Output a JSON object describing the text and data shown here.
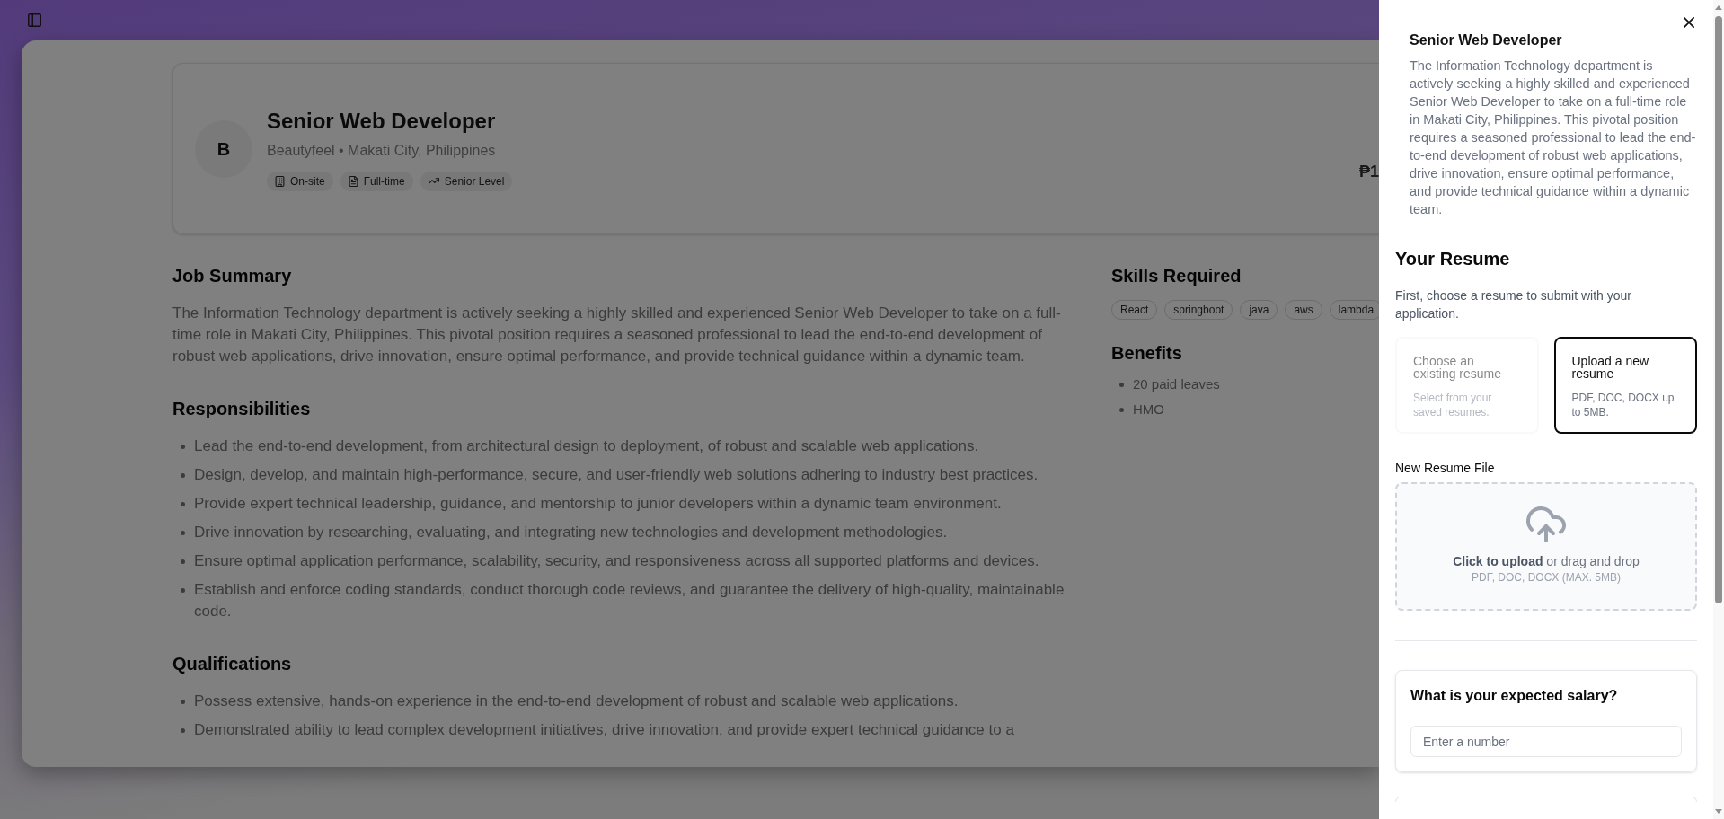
{
  "job": {
    "initial": "B",
    "title": "Senior Web Developer",
    "subtitle": "Beautyfeel • Makati City, Philippines",
    "tags": [
      {
        "kind": "workplace",
        "label": "On-site"
      },
      {
        "kind": "employment",
        "label": "Full-time"
      },
      {
        "kind": "level",
        "label": "Senior Level"
      }
    ],
    "salary": "₱1"
  },
  "sections": [
    {
      "kind": "paragraph",
      "heading": "Job Summary",
      "text": "The Information Technology department is actively seeking a highly skilled and experienced Senior Web Developer to take on a full-time role in Makati City, Philippines. This pivotal position requires a seasoned professional to lead the end-to-end development of robust web applications, drive innovation, ensure optimal performance, and provide technical guidance within a dynamic team."
    },
    {
      "kind": "list",
      "heading": "Responsibilities",
      "items": [
        "Lead the end-to-end development, from architectural design to deployment, of robust and scalable web applications.",
        "Design, develop, and maintain high-performance, secure, and user-friendly web solutions adhering to industry best practices.",
        "Provide expert technical leadership, guidance, and mentorship to junior developers within a dynamic team environment.",
        "Drive innovation by researching, evaluating, and integrating new technologies and development methodologies.",
        "Ensure optimal application performance, scalability, security, and responsiveness across all supported platforms and devices.",
        "Establish and enforce coding standards, conduct thorough code reviews, and guarantee the delivery of high-quality, maintainable code."
      ]
    },
    {
      "kind": "list",
      "heading": "Qualifications",
      "items": [
        "Possess extensive, hands-on experience in the end-to-end development of robust and scalable web applications.",
        "Demonstrated ability to lead complex development initiatives, drive innovation, and provide expert technical guidance to a"
      ]
    }
  ],
  "aside": {
    "skills": {
      "heading": "Skills Required",
      "items": [
        "React",
        "springboot",
        "java",
        "aws",
        "lambda"
      ]
    },
    "benefits": {
      "heading": "Benefits",
      "items": [
        "20 paid leaves",
        "HMO"
      ]
    }
  },
  "panel": {
    "title": "Senior Web Developer",
    "description": "The Information Technology department is actively seeking a highly skilled and experienced Senior Web Developer to take on a full-time role in Makati City, Philippines. This pivotal position requires a seasoned professional to lead the end-to-end development of robust web applications, drive innovation, ensure optimal performance, and provide technical guidance within a dynamic team.",
    "resume": {
      "heading": "Your Resume",
      "intro": "First, choose a resume to submit with your application.",
      "options": [
        {
          "title": "Choose an existing resume",
          "description": "Select from your saved resumes.",
          "selected": false,
          "disabled": true
        },
        {
          "title": "Upload a new resume",
          "description": "PDF, DOC, DOCX up to 5MB.",
          "selected": true,
          "disabled": false
        }
      ],
      "file_label": "New Resume File",
      "dropzone": {
        "prompt": "**Click to upload** or drag and drop",
        "hint": "PDF, DOC, DOCX (MAX. 5MB)"
      }
    },
    "salary_question": {
      "question": "What is your expected salary?",
      "placeholder": "Enter a number"
    }
  }
}
